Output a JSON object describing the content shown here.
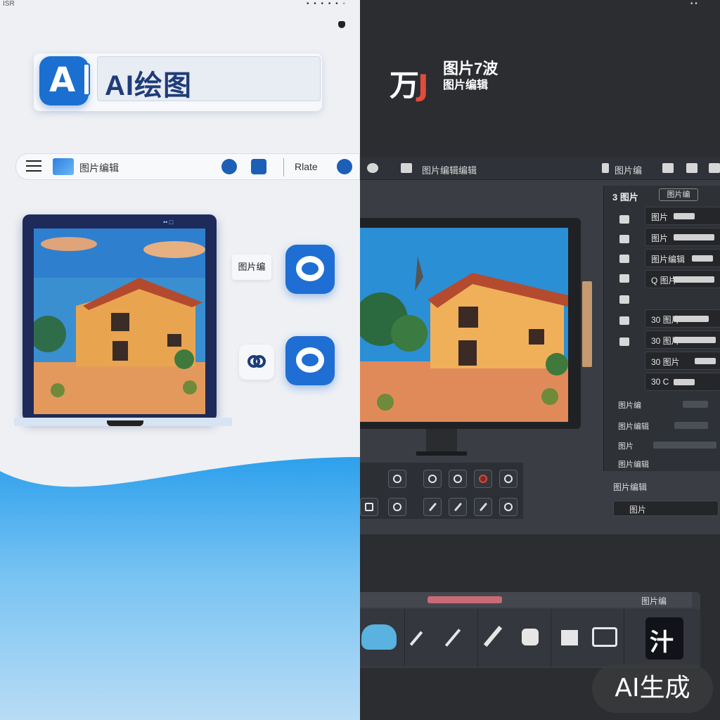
{
  "left": {
    "corner_text": "ISR",
    "logo": {
      "badge_text": "A",
      "title": "AI绘图"
    },
    "toolbar": {
      "label": "图片编辑",
      "right_label": "Rlate"
    },
    "tablet": {
      "top_label": "•• □"
    },
    "chip_label": "图片编"
  },
  "right": {
    "logo": {
      "big": "万",
      "big_accent": "J",
      "line1": "图片7波",
      "line2": "图片编辑"
    },
    "editor": {
      "bar_title": "图片编辑编辑",
      "bar_right": "图片编",
      "props_head": "3 图片",
      "props_btn": "图片编",
      "rows": [
        {
          "n": "图片"
        },
        {
          "n": "图片"
        },
        {
          "n": "图片编辑"
        },
        {
          "n": "Q 图片"
        },
        {
          "n": "30 图片"
        },
        {
          "n": "30 图片"
        },
        {
          "n": "30 图片"
        },
        {
          "n": "30 C"
        }
      ],
      "subs": [
        "图片编",
        "图片编辑",
        "图片",
        "图片编辑"
      ],
      "side_label": "图片编辑",
      "side_row": "图片"
    },
    "dock": {
      "label": "图片编"
    },
    "final_icon": "汁"
  },
  "watermark": "AI生成",
  "colors": {
    "accent_blue": "#1f6ed4",
    "dark_bg": "#2b2d31",
    "accent_red": "#c96a77"
  }
}
